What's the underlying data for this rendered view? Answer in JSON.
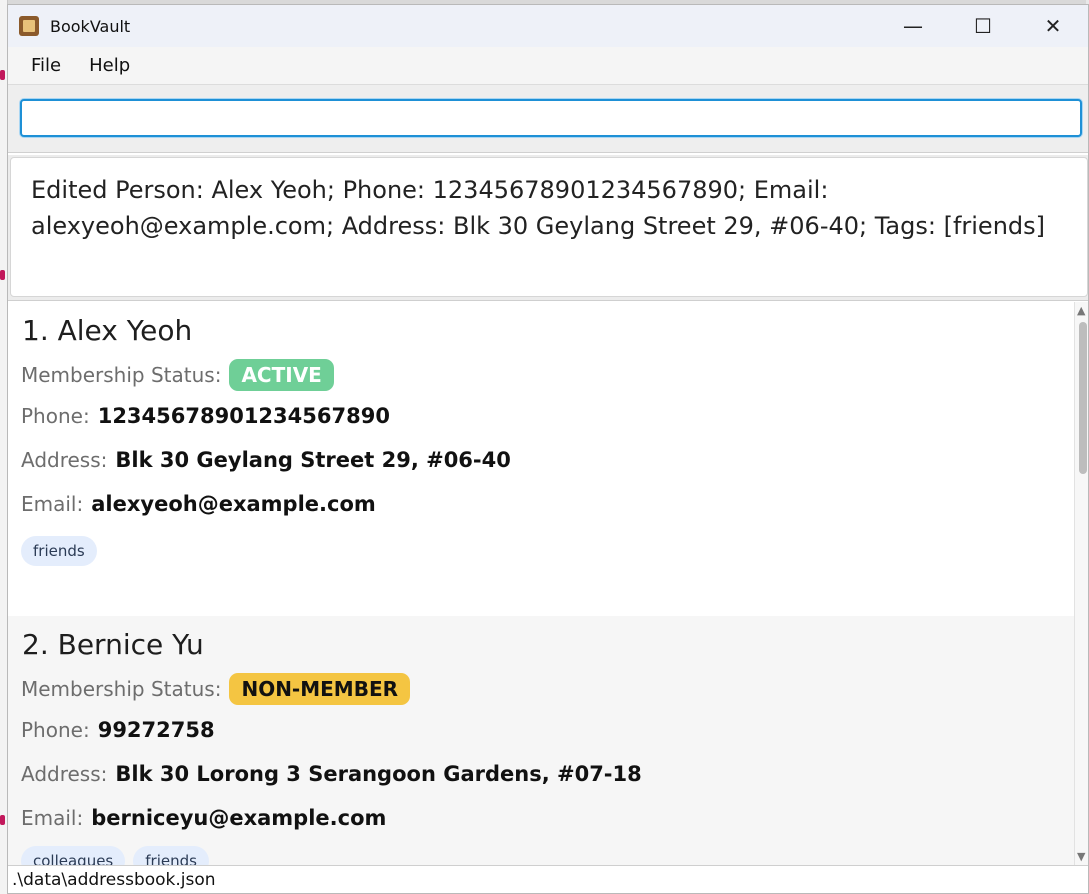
{
  "window": {
    "title": "BookVault",
    "controls": {
      "minimize": "—",
      "maximize": "☐",
      "close": "✕"
    }
  },
  "menu": {
    "file": "File",
    "help": "Help"
  },
  "command": {
    "value": "",
    "placeholder": ""
  },
  "result": {
    "message": "Edited Person: Alex Yeoh; Phone: 12345678901234567890; Email: alexyeoh@example.com; Address: Blk 30 Geylang Street 29, #06-40; Tags: [friends]"
  },
  "labels": {
    "membership": "Membership Status:",
    "phone": "Phone:",
    "address": "Address:",
    "email": "Email:"
  },
  "persons": [
    {
      "name": "1.  Alex Yeoh",
      "status": "ACTIVE",
      "phone": "12345678901234567890",
      "address": "Blk 30 Geylang Street 29, #06-40",
      "email": "alexyeoh@example.com",
      "tags": [
        "friends"
      ]
    },
    {
      "name": "2.  Bernice Yu",
      "status": "NON-MEMBER",
      "phone": "99272758",
      "address": "Blk 30 Lorong 3 Serangoon Gardens, #07-18",
      "email": "berniceyu@example.com",
      "tags": [
        "colleagues",
        "friends"
      ]
    }
  ],
  "statusbar": {
    "path": ".\\data\\addressbook.json"
  },
  "colors": {
    "active_badge": "#6fcf97",
    "nonmember_badge": "#f4c542",
    "input_focus": "#1e90d6",
    "tag_bg": "#e4edfc"
  },
  "icons": {
    "app": "bookvault-app-icon",
    "minimize": "minimize-icon",
    "maximize": "maximize-icon",
    "close": "close-icon"
  }
}
